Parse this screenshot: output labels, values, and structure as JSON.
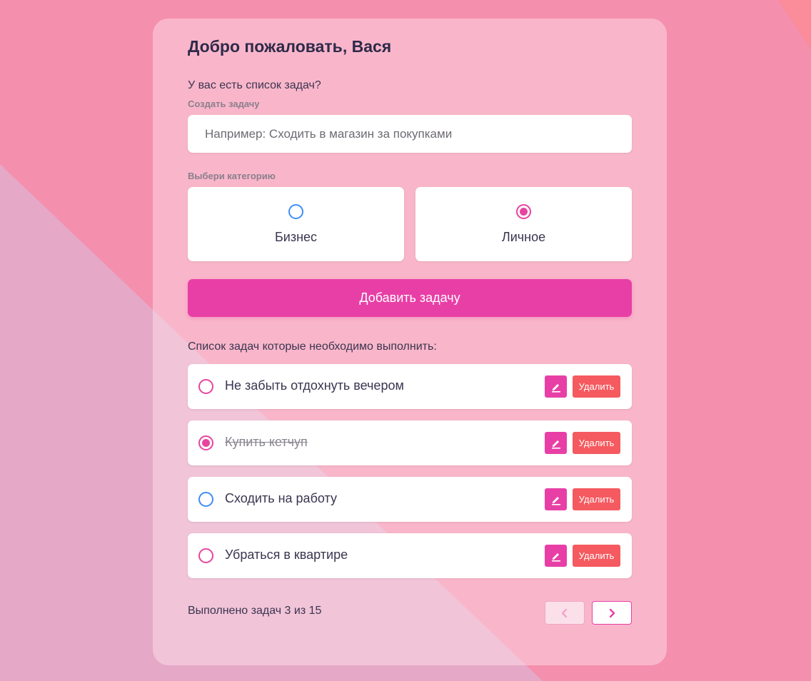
{
  "header": {
    "title": "Добро пожаловать, Вася"
  },
  "form": {
    "question": "У вас есть список задач?",
    "create_label": "Создать задачу",
    "task_placeholder": "Например: Сходить в магазин за покупками",
    "category_label": "Выбери категорию",
    "categories": [
      {
        "label": "Бизнес",
        "selected": false,
        "color": "#3e8ef5"
      },
      {
        "label": "Личное",
        "selected": true,
        "color": "#e8449f"
      }
    ],
    "add_button": "Добавить задачу"
  },
  "tasks": {
    "title": "Список задач которые необходимо выполнить:",
    "items": [
      {
        "text": "Не забыть отдохнуть вечером",
        "done": false,
        "category": "personal",
        "delete_label": "Удалить"
      },
      {
        "text": "Купить кетчуп",
        "done": true,
        "category": "personal",
        "delete_label": "Удалить"
      },
      {
        "text": "Сходить на работу",
        "done": false,
        "category": "business",
        "delete_label": "Удалить"
      },
      {
        "text": "Убраться в квартире",
        "done": false,
        "category": "personal",
        "delete_label": "Удалить"
      }
    ]
  },
  "footer": {
    "summary": "Выполнено задач 3 из 15",
    "prev_icon": "chevron-left-icon",
    "next_icon": "chevron-right-icon"
  },
  "colors": {
    "accent": "#e83fa6",
    "delete": "#f45a5f",
    "business": "#3e8ef5",
    "personal": "#e8449f"
  }
}
